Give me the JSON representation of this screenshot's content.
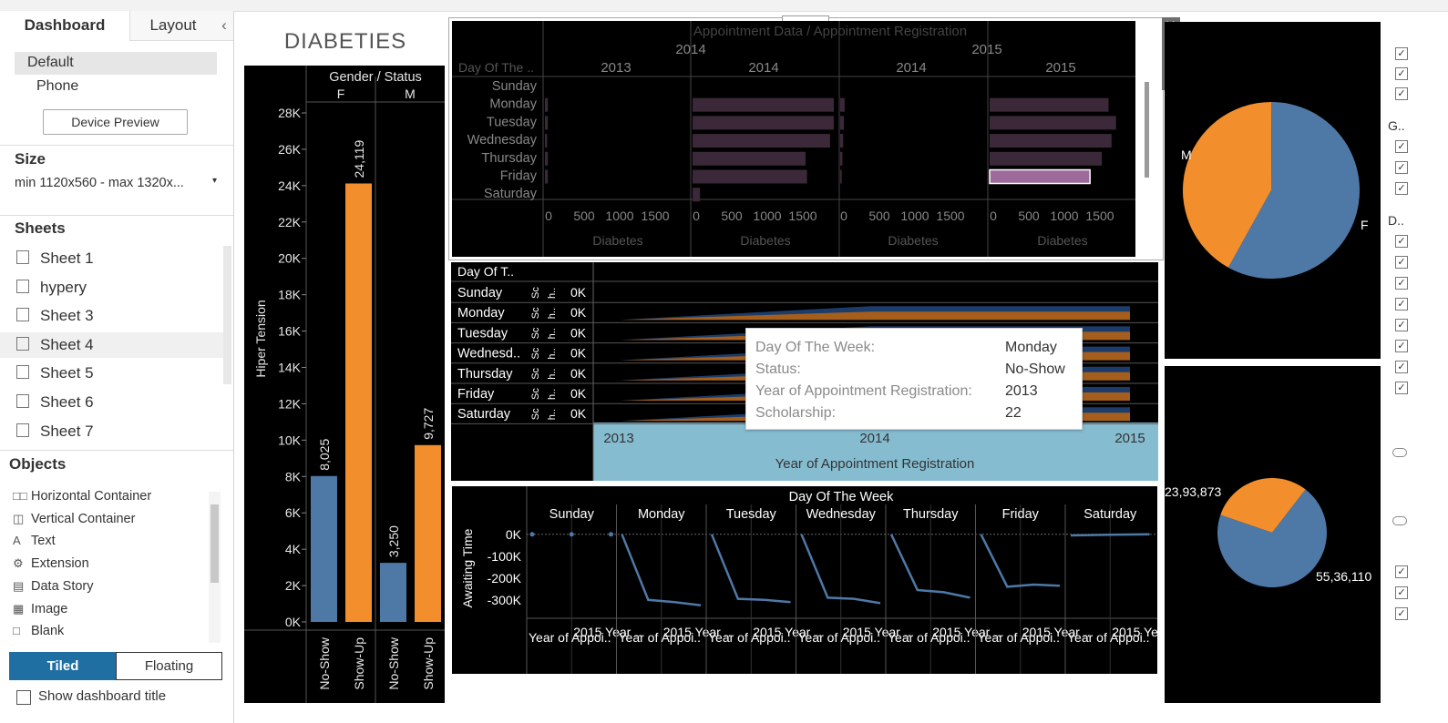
{
  "left_panel": {
    "tabs": [
      "Dashboard",
      "Layout"
    ],
    "collapse_icon": "chevron-left-icon",
    "devices": [
      "Default",
      "Phone"
    ],
    "device_preview_label": "Device Preview",
    "size_header": "Size",
    "size_value": "min 1120x560 - max 1320x...",
    "sheets_header": "Sheets",
    "sheets": [
      "Sheet 1",
      "hypery",
      "Sheet 3",
      "Sheet 4",
      "Sheet 5",
      "Sheet 6",
      "Sheet 7"
    ],
    "objects_header": "Objects",
    "objects": [
      {
        "label": "Horizontal Container",
        "icon": "horizontal-container-icon"
      },
      {
        "label": "Vertical Container",
        "icon": "vertical-container-icon"
      },
      {
        "label": "Text",
        "icon": "text-icon"
      },
      {
        "label": "Extension",
        "icon": "extension-icon"
      },
      {
        "label": "Data Story",
        "icon": "data-story-icon"
      },
      {
        "label": "Image",
        "icon": "image-icon"
      },
      {
        "label": "Blank",
        "icon": "blank-icon"
      }
    ],
    "tiled_label": "Tiled",
    "floating_label": "Floating",
    "show_title_label": "Show dashboard title"
  },
  "dashboard": {
    "title": "DIABETIES",
    "colors": {
      "blue": "#4e79a7",
      "orange": "#f28e2b",
      "purple": "#9e6a9b",
      "dark_purple": "#3b2838",
      "teal": "#86bcd0"
    }
  },
  "chart_data": [
    {
      "type": "bar",
      "title": "Gender / Status",
      "ylabel": "Hiper Tension",
      "ylim": [
        0,
        28000
      ],
      "y_ticks": [
        "0K",
        "2K",
        "4K",
        "6K",
        "8K",
        "10K",
        "12K",
        "14K",
        "16K",
        "18K",
        "20K",
        "22K",
        "24K",
        "26K",
        "28K"
      ],
      "groups": [
        "F",
        "M"
      ],
      "categories": [
        "No-Show",
        "Show-Up",
        "No-Show",
        "Show-Up"
      ],
      "values": [
        8025,
        24119,
        3250,
        9727
      ],
      "value_labels": [
        "8,025",
        "24,119",
        "3,250",
        "9,727"
      ],
      "colors": [
        "#4e79a7",
        "#f28e2b",
        "#4e79a7",
        "#f28e2b"
      ]
    },
    {
      "type": "bar",
      "title": "Appointment Data / Appointment Registration",
      "row_header": "Day Of The ..",
      "top_years": [
        "2014",
        "2015"
      ],
      "panel_years": [
        "2013",
        "2014",
        "2014",
        "2015"
      ],
      "rows": [
        "Sunday",
        "Monday",
        "Tuesday",
        "Wednesday",
        "Thursday",
        "Friday",
        "Saturday"
      ],
      "x_ticks": [
        "0",
        "500",
        "1000",
        "1500"
      ],
      "xlabel": "Diabetes",
      "xlim": [
        0,
        1900
      ],
      "series": [
        {
          "values": [
            0,
            40,
            40,
            30,
            40,
            40,
            0
          ]
        },
        {
          "values": [
            0,
            1900,
            1900,
            1850,
            1520,
            1540,
            100
          ]
        },
        {
          "values": [
            0,
            60,
            50,
            40,
            30,
            20,
            0
          ]
        },
        {
          "values": [
            0,
            1600,
            1700,
            1640,
            1510,
            1350,
            0
          ]
        }
      ]
    },
    {
      "type": "area",
      "row_header": "Day Of T..",
      "rows": [
        "Sunday",
        "Monday",
        "Tuesday",
        "Wednesd..",
        "Thursday",
        "Friday",
        "Saturday"
      ],
      "row_subheaders": [
        "Sc",
        "h..",
        "0K"
      ],
      "x": [
        "2013",
        "2014",
        "2015"
      ],
      "xlabel": "Year of Appointment Registration"
    },
    {
      "type": "line",
      "title": "Day Of The Week",
      "ylabel": "Awaiting Time",
      "y_ticks": [
        "0K",
        "-100K",
        "-200K",
        "-300K"
      ],
      "ylim": [
        -330000,
        20000
      ],
      "categories": [
        "Sunday",
        "Monday",
        "Tuesday",
        "Wednesday",
        "Thursday",
        "Friday",
        "Saturday"
      ],
      "sub_columns": [
        "Year of Appoi..",
        "2015 Year .."
      ],
      "series": [
        {
          "values": [
            [
              0,
              0,
              0
            ],
            [
              0,
              -300000,
              -310000,
              -325000
            ],
            [
              0,
              -295000,
              -300000,
              -310000
            ],
            [
              0,
              -290000,
              -295000,
              -315000
            ],
            [
              0,
              -255000,
              -265000,
              -290000
            ],
            [
              0,
              -240000,
              -230000,
              -235000
            ],
            [
              -5000,
              -2000,
              0
            ]
          ]
        }
      ]
    },
    {
      "type": "pie",
      "labels": [
        "M",
        "F"
      ],
      "values": [
        42,
        58
      ],
      "colors": [
        "#f28e2b",
        "#4e79a7"
      ]
    },
    {
      "type": "pie",
      "labels": [
        "23,93,873",
        "55,36,110"
      ],
      "values": [
        2393873,
        5536110
      ],
      "colors": [
        "#f28e2b",
        "#4e79a7"
      ]
    }
  ],
  "tooltip": {
    "rows": [
      {
        "key": "Day Of The Week:",
        "value": "Monday"
      },
      {
        "key": "Status:",
        "value": "No-Show"
      },
      {
        "key": "Year of Appointment Registration:",
        "value": "2013"
      },
      {
        "key": "Scholarship:",
        "value": "22"
      }
    ]
  },
  "right_filter": {
    "labels": [
      "G..",
      "D.."
    ]
  }
}
